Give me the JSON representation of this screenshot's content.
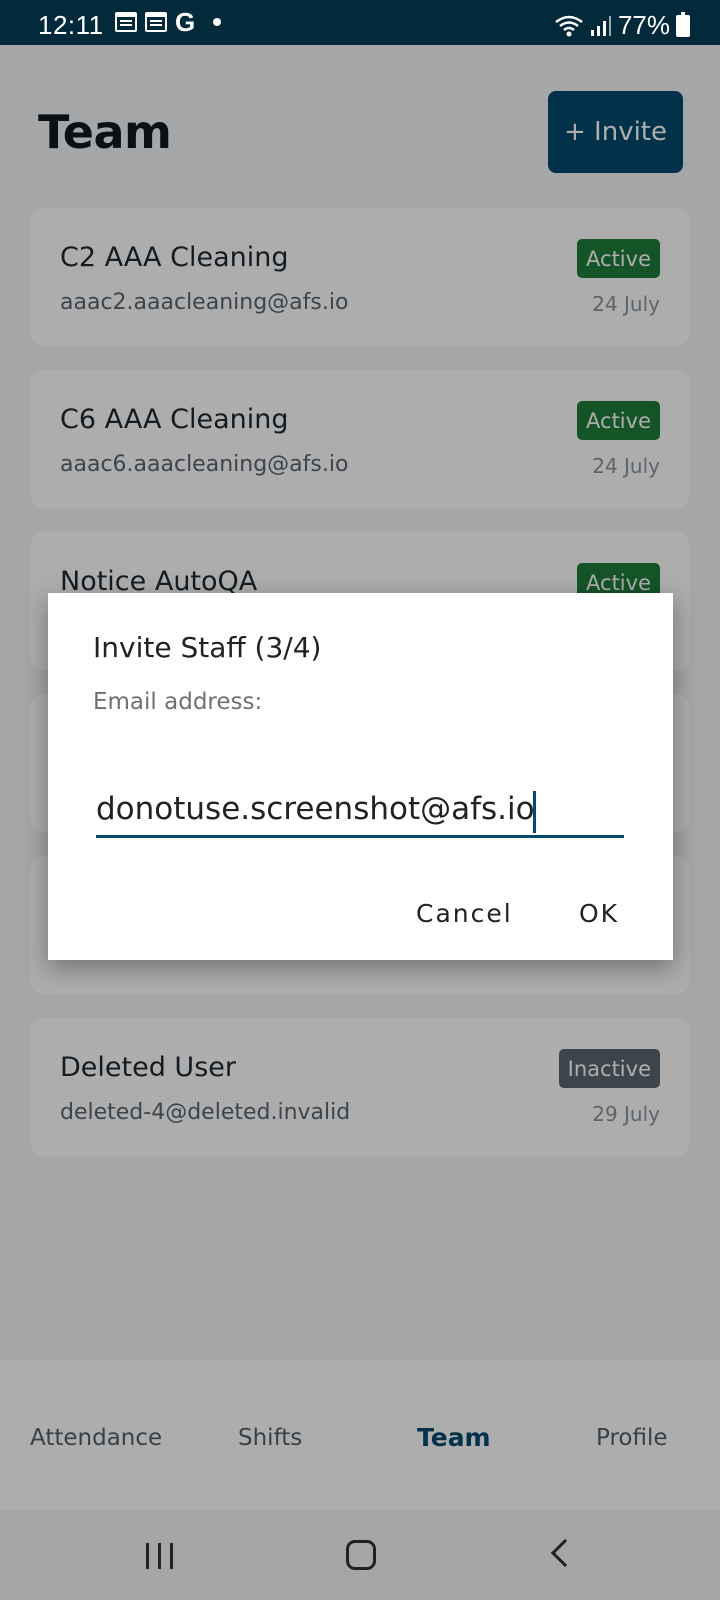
{
  "status_bar": {
    "time": "12:11",
    "battery": "77%",
    "icons": [
      "calendar-icon",
      "calendar-icon",
      "google-icon",
      "dot-icon",
      "wifi-icon",
      "signal-icon",
      "battery-icon"
    ]
  },
  "header": {
    "title": "Team",
    "invite_label": "+ Invite"
  },
  "members": [
    {
      "name": "C2 AAA Cleaning",
      "email": "aaac2.aaacleaning@afs.io",
      "status": "Active",
      "date": "24 July"
    },
    {
      "name": "C6 AAA Cleaning",
      "email": "aaac6.aaacleaning@afs.io",
      "status": "Active",
      "date": "24 July"
    },
    {
      "name": "Notice AutoQA",
      "email": "",
      "status": "Active",
      "date": ""
    },
    {
      "name": "Deleted User",
      "email": "deleted-4@deleted.invalid",
      "status": "Inactive",
      "date": "29 July"
    }
  ],
  "dialog": {
    "title": "Invite Staff (3/4)",
    "label": "Email address:",
    "input_value": "donotuse.screenshot@afs.io",
    "cancel_label": "Cancel",
    "ok_label": "OK"
  },
  "bottom_nav": {
    "items": [
      "Attendance",
      "Shifts",
      "Team",
      "Profile"
    ],
    "active": "Team"
  },
  "colors": {
    "primary": "#034a6c",
    "status_bar": "#022a3b",
    "active_badge": "#1f7d3a",
    "inactive_badge": "#5b6670"
  }
}
